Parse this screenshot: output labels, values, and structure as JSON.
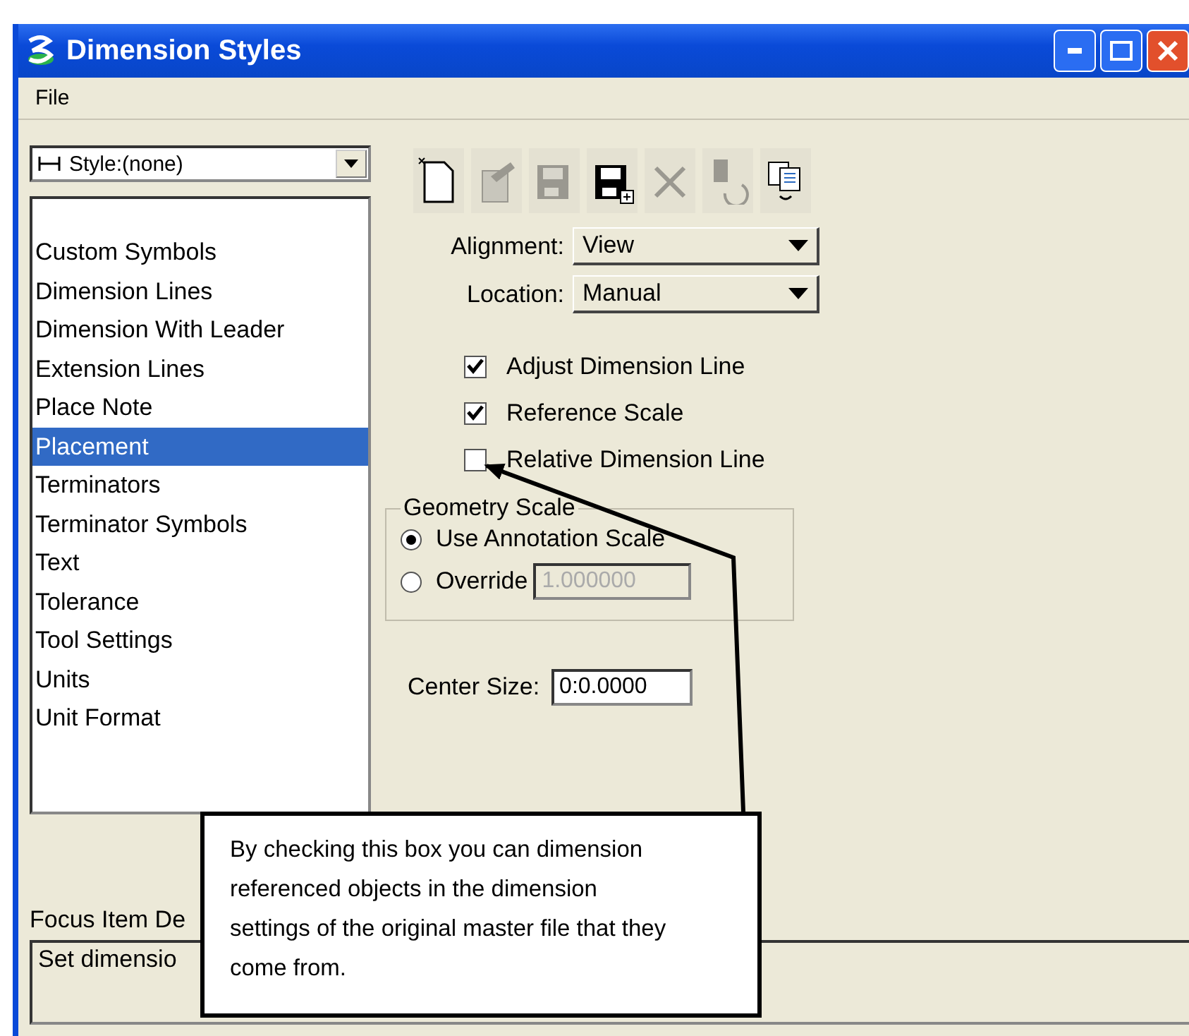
{
  "window": {
    "title": "Dimension Styles"
  },
  "menu": [
    "File"
  ],
  "style_dropdown": {
    "value": "Style:(none)"
  },
  "toolbar": [
    {
      "kind": "new",
      "disabled": false
    },
    {
      "kind": "edit",
      "disabled": true
    },
    {
      "kind": "save",
      "disabled": true
    },
    {
      "kind": "save-as",
      "disabled": false
    },
    {
      "kind": "delete",
      "disabled": true
    },
    {
      "kind": "undo",
      "disabled": true
    },
    {
      "kind": "compare",
      "disabled": false
    }
  ],
  "categories": [
    {
      "label": "Custom Symbols",
      "selected": false
    },
    {
      "label": "Dimension Lines",
      "selected": false
    },
    {
      "label": "Dimension With Leader",
      "selected": false
    },
    {
      "label": "Extension Lines",
      "selected": false
    },
    {
      "label": "Place Note",
      "selected": false
    },
    {
      "label": "Placement",
      "selected": true
    },
    {
      "label": "Terminators",
      "selected": false
    },
    {
      "label": "Terminator Symbols",
      "selected": false
    },
    {
      "label": "Text",
      "selected": false
    },
    {
      "label": "Tolerance",
      "selected": false
    },
    {
      "label": "Tool Settings",
      "selected": false
    },
    {
      "label": "Units",
      "selected": false
    },
    {
      "label": "Unit Format",
      "selected": false
    }
  ],
  "dropdowns": [
    {
      "label": "Alignment:",
      "value": "View"
    },
    {
      "label": "Location:",
      "value": "Manual"
    }
  ],
  "checkboxes": [
    {
      "label": "Adjust Dimension Line",
      "checked": true
    },
    {
      "label": "Reference Scale",
      "checked": true
    },
    {
      "label": "Relative Dimension Line",
      "checked": false
    }
  ],
  "geometry_scale": {
    "title": "Geometry Scale",
    "options": [
      {
        "label": "Use Annotation Scale",
        "selected": true
      },
      {
        "label": "Override",
        "selected": false
      }
    ],
    "override_value": "1.000000"
  },
  "center_size": {
    "label": "Center Size:",
    "value": "0:0.0000"
  },
  "focus_item": {
    "label": "Focus Item De",
    "text": "Set dimensio"
  },
  "callout": {
    "text": "By checking this box you can dimension referenced objects in the dimension settings of the original master file that they come from."
  }
}
